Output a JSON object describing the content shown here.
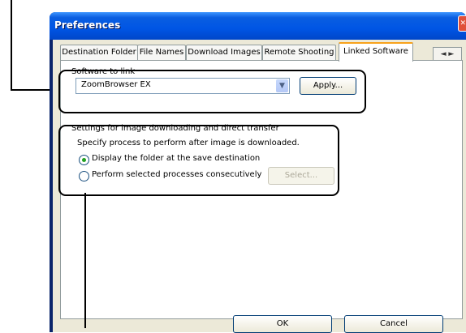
{
  "window": {
    "title": "Preferences"
  },
  "tabs": [
    {
      "label": "Destination Folder"
    },
    {
      "label": "File Names"
    },
    {
      "label": "Download Images"
    },
    {
      "label": "Remote Shooting"
    },
    {
      "label": "Linked Software",
      "active": true
    }
  ],
  "tab_scroll": {
    "icon": "left-right-arrows-icon",
    "glyph": "◄ ►"
  },
  "software_group": {
    "label": "Software to link",
    "selected_value": "ZoomBrowser EX",
    "apply_label": "Apply..."
  },
  "download_group": {
    "title": "Settings for image downloading and direct transfer",
    "instruction": "Specify process to perform after image is downloaded.",
    "options": [
      {
        "label": "Display the folder at the save destination",
        "selected": true
      },
      {
        "label": "Perform selected processes consecutively",
        "selected": false
      }
    ],
    "select_label": "Select..."
  },
  "footer": {
    "ok_label": "OK",
    "cancel_label": "Cancel"
  },
  "colors": {
    "title_bar": "#0055e5",
    "dialog_bg": "#ece9d8",
    "active_tab_accent": "#f7a21b",
    "callout": "#000000"
  }
}
